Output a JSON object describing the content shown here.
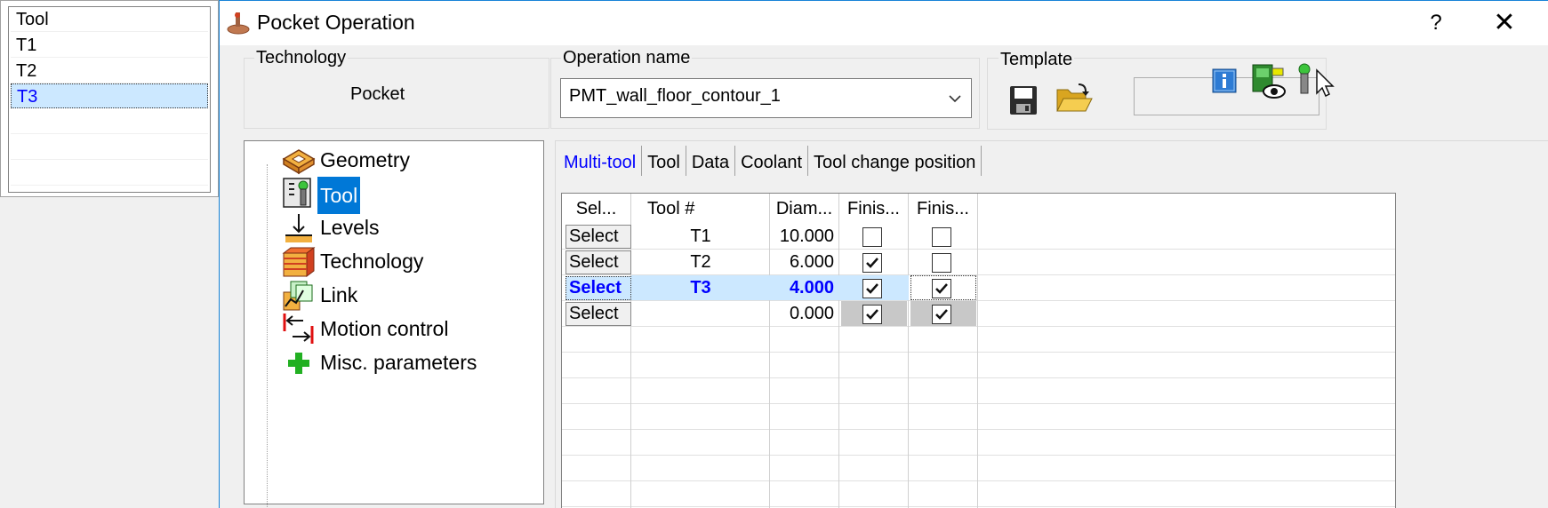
{
  "tool_list": {
    "header": "Tool",
    "items": [
      "T1",
      "T2",
      "T3"
    ],
    "selected_index": 2
  },
  "dialog": {
    "title": "Pocket Operation",
    "help_label": "?",
    "close_label": "✕",
    "technology": {
      "label": "Technology",
      "value": "Pocket"
    },
    "operation_name": {
      "label": "Operation name",
      "value": "PMT_wall_floor_contour_1"
    },
    "template": {
      "label": "Template",
      "field_value": ""
    },
    "icons": [
      "save-icon",
      "open-folder-icon",
      "info-icon",
      "view-machine-icon",
      "tool-pick-icon"
    ]
  },
  "tree": {
    "items": [
      {
        "label": "Geometry",
        "icon": "geometry-icon"
      },
      {
        "label": "Tool",
        "icon": "tool-icon",
        "selected": true
      },
      {
        "label": "Levels",
        "icon": "levels-icon"
      },
      {
        "label": "Technology",
        "icon": "technology-icon"
      },
      {
        "label": "Link",
        "icon": "link-icon"
      },
      {
        "label": "Motion control",
        "icon": "motion-control-icon"
      },
      {
        "label": "Misc. parameters",
        "icon": "misc-parameters-icon"
      }
    ]
  },
  "tabs": [
    {
      "label": "Multi-tool",
      "active": true
    },
    {
      "label": "Tool"
    },
    {
      "label": "Data"
    },
    {
      "label": "Coolant"
    },
    {
      "label": "Tool change position"
    }
  ],
  "grid": {
    "columns": [
      "Sel...",
      "Tool #",
      "Diam...",
      "Finis...",
      "Finis..."
    ],
    "rows": [
      {
        "select": "Select",
        "tool": "T1",
        "diameter": "10.000",
        "finish1": false,
        "finish2": false
      },
      {
        "select": "Select",
        "tool": "T2",
        "diameter": "6.000",
        "finish1": true,
        "finish2": false
      },
      {
        "select": "Select",
        "tool": "T3",
        "diameter": "4.000",
        "finish1": true,
        "finish2": true,
        "selected": true
      },
      {
        "select": "Select",
        "tool": "",
        "diameter": "0.000",
        "finish1": true,
        "finish2": true
      }
    ]
  },
  "colors": {
    "accent": "#0078d7",
    "selection_bg": "#cce8ff",
    "selected_text": "#0000ff"
  }
}
